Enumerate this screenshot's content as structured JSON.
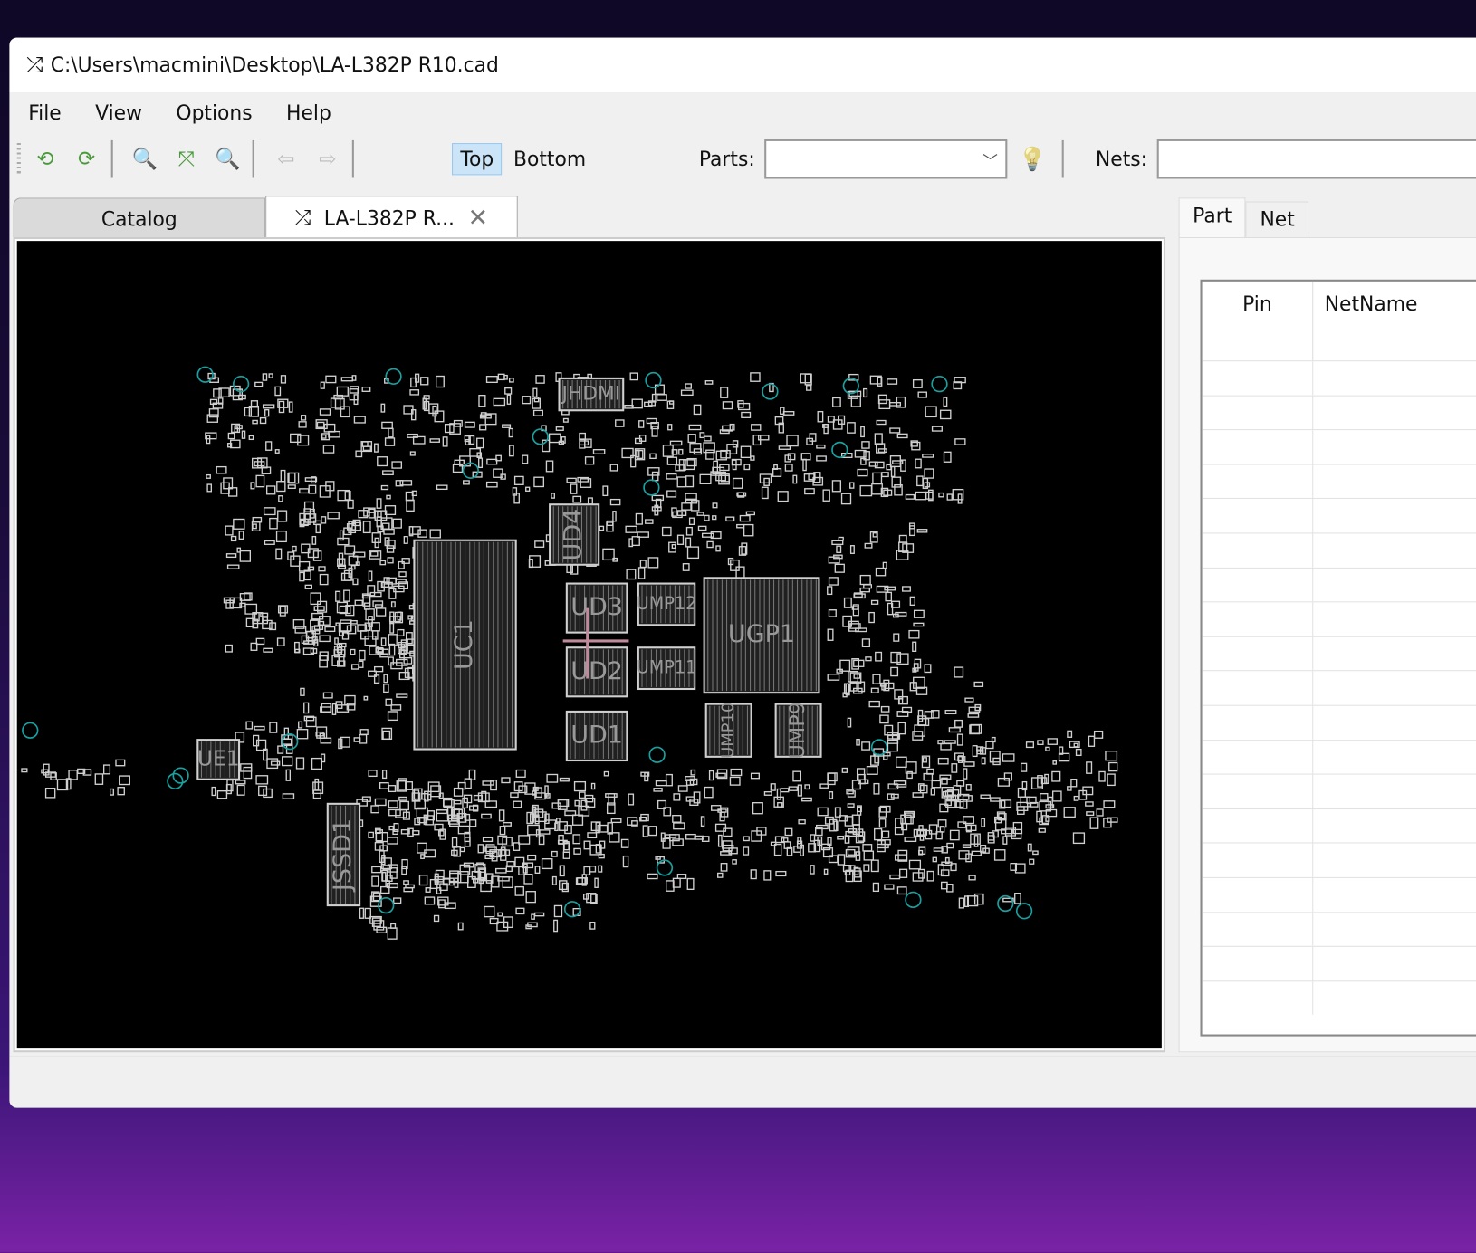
{
  "window": {
    "title": "C:\\Users\\macmini\\Desktop\\LA-L382P R10.cad",
    "app_icon": "shuffle-icon"
  },
  "menu": [
    "File",
    "View",
    "Options",
    "Help"
  ],
  "toolbar": {
    "buttons": [
      {
        "name": "reload-icon",
        "glyph": "⟲",
        "color": "#4a9a3c"
      },
      {
        "name": "rotate-icon",
        "glyph": "⟳",
        "color": "#4a9a3c"
      },
      {
        "name": "zoom-out-icon",
        "glyph": "🔍",
        "color": "#c33"
      },
      {
        "name": "fit-icon",
        "glyph": "⤧",
        "color": "#4a9a3c"
      },
      {
        "name": "zoom-in-icon",
        "glyph": "🔍",
        "color": "#4a9a3c"
      },
      {
        "name": "back-icon",
        "glyph": "⇦",
        "color": "#bbb"
      },
      {
        "name": "forward-icon",
        "glyph": "⇨",
        "color": "#bbb"
      }
    ],
    "top": "Top",
    "bottom": "Bottom",
    "selected_side": "Top",
    "parts_label": "Parts:",
    "parts_value": "",
    "nets_label": "Nets:",
    "nets_value": ""
  },
  "tabs": {
    "catalog": "Catalog",
    "doc": "LA-L382P R...",
    "doc_icon": "shuffle-icon"
  },
  "board": {
    "background": "#000000",
    "part_color": "#d0d0d0",
    "hole_color": "#1aa0a0",
    "labels": [
      "UC1",
      "UD3",
      "UD2",
      "UD1",
      "UD4",
      "UGP1",
      "UMP12",
      "UMP11",
      "UMP10",
      "UMP9",
      "UE1",
      "JSSD1",
      "JHDMI"
    ]
  },
  "panel": {
    "tabs": [
      "Part",
      "Net"
    ],
    "active": "Part",
    "columns": [
      "Pin",
      "NetName"
    ],
    "rows": 19
  }
}
